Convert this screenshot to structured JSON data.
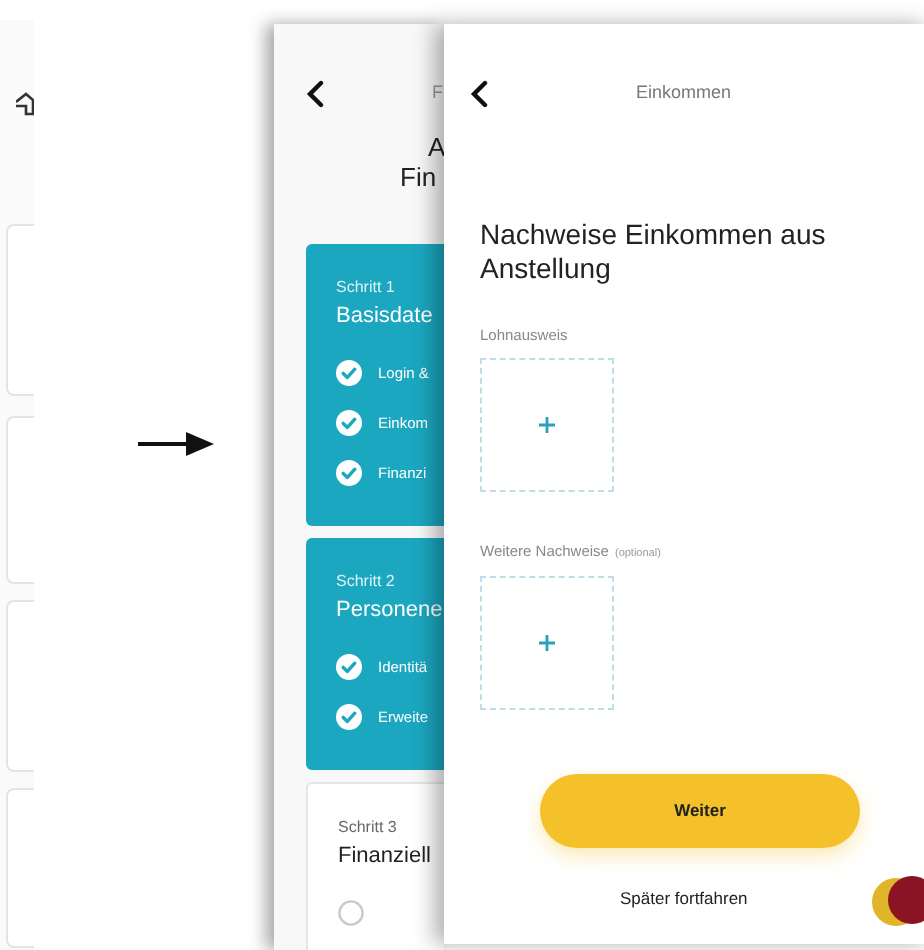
{
  "middle_screen": {
    "header_title": "F",
    "heading_lines": [
      "A",
      "Fin"
    ],
    "steps": [
      {
        "label": "Schritt 1",
        "title": "Basisdate",
        "completed": true,
        "tasks": [
          {
            "label": "Login &",
            "done": true
          },
          {
            "label": "Einkom",
            "done": true
          },
          {
            "label": "Finanzi",
            "done": true
          }
        ]
      },
      {
        "label": "Schritt 2",
        "title": "Personene",
        "completed": true,
        "tasks": [
          {
            "label": "Identitä",
            "done": true
          },
          {
            "label": "Erweite",
            "done": true
          }
        ]
      },
      {
        "label": "Schritt 3",
        "title": "Finanziell",
        "completed": false,
        "tasks": [
          {
            "done": false
          }
        ]
      }
    ]
  },
  "front_screen": {
    "title": "Einkommen",
    "heading": "Nachweise Einkommen aus Anstellung",
    "uploads": [
      {
        "label": "Lohnausweis"
      },
      {
        "label": "Weitere Nachweise",
        "note": "(optional)"
      }
    ],
    "primary_button": "Weiter",
    "secondary_link": "Später fortfahren"
  }
}
